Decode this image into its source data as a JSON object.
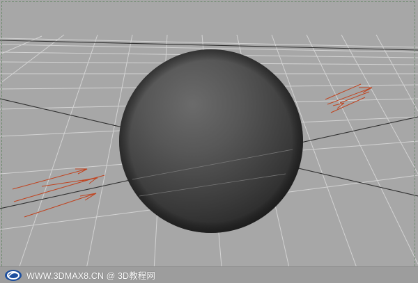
{
  "viewport": {
    "name": "perspective-viewport"
  },
  "watermark": {
    "text": "WWW.3DMAX8.CN @ 3D教程网",
    "logo_icon": "3dmax8-logo-icon",
    "text_color": "#ffffff"
  },
  "scene": {
    "background": "#a7a7a7",
    "grid_color": "#d2d2d2",
    "axis_color": "#2b2b2b",
    "sphere_color": "#3c3c3c",
    "arrow_color": "#c0421f"
  }
}
